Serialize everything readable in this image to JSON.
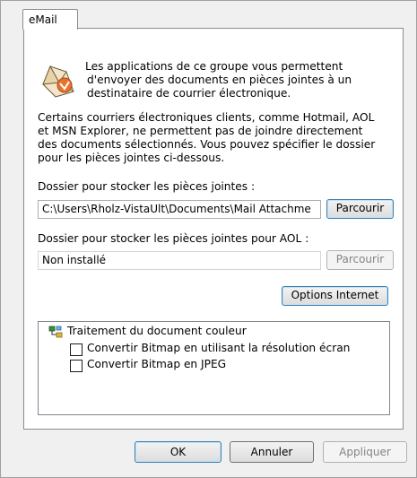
{
  "tab": {
    "label": "eMail"
  },
  "description": {
    "lines": [
      "Les applications de ce groupe vous permettent",
      "d'envoyer des documents en pièces jointes à un",
      "destinataire de courrier électronique."
    ]
  },
  "info": {
    "lines": [
      "Certains courriers électroniques clients, comme Hotmail, AOL",
      "et MSN Explorer, ne permettent pas de joindre directement",
      "des documents sélectionnés. Vous pouvez spécifier le dossier",
      "pour les pièces jointes ci-dessous."
    ]
  },
  "attachments_folder": {
    "label": "Dossier pour stocker les pièces jointes :",
    "value": "C:\\Users\\Rholz-VistaUlt\\Documents\\Mail Attachme",
    "browse_label": "Parcourir"
  },
  "aol_folder": {
    "label": "Dossier pour stocker les pièces jointes pour AOL :",
    "value": "Non installé",
    "browse_label": "Parcourir"
  },
  "internet_options_label": "Options Internet",
  "color_processing": {
    "title": "Traitement du document couleur",
    "options": [
      {
        "label": "Convertir Bitmap en utilisant la résolution écran",
        "checked": false
      },
      {
        "label": "Convertir Bitmap en JPEG",
        "checked": false
      }
    ]
  },
  "footer": {
    "ok_label": "OK",
    "cancel_label": "Annuler",
    "apply_label": "Appliquer"
  }
}
